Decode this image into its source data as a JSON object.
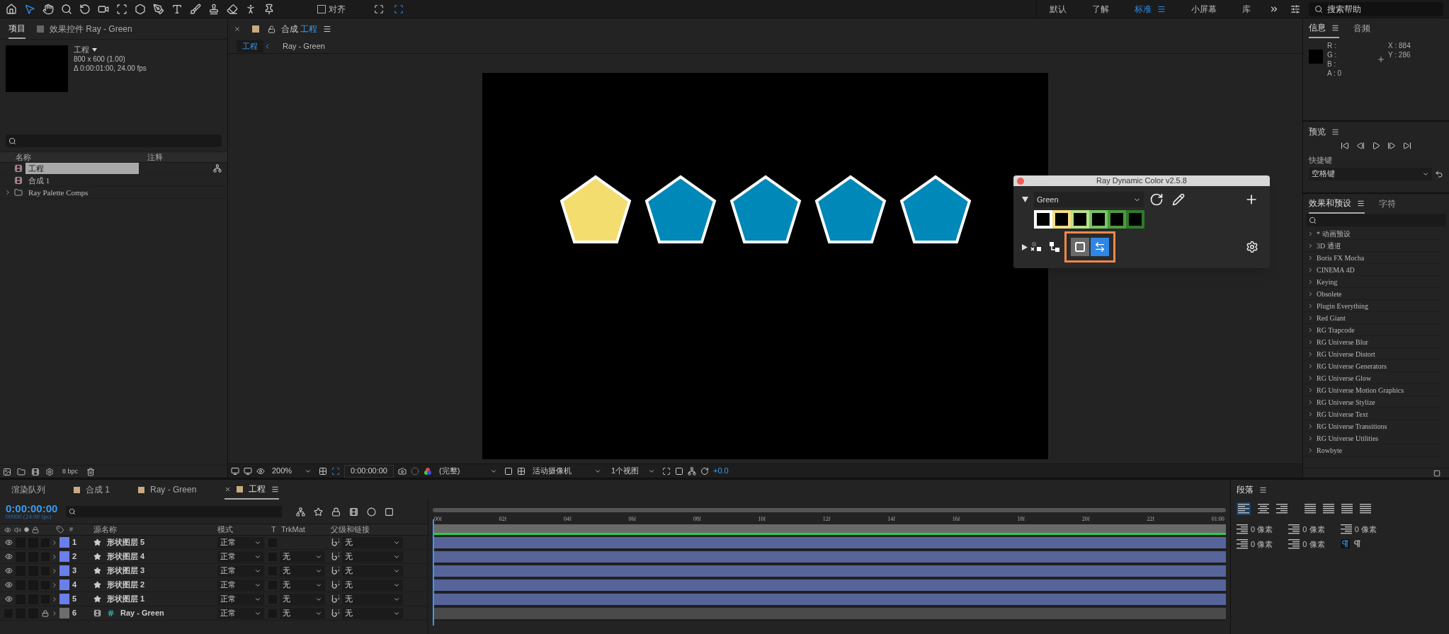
{
  "toolbar": {
    "snap": {
      "label": "对齐",
      "checked": false
    },
    "workspaces": [
      {
        "label": "默认",
        "selected": false
      },
      {
        "label": "了解",
        "selected": false
      },
      {
        "label": "标准",
        "selected": true
      },
      {
        "label": "小屏幕",
        "selected": false
      },
      {
        "label": "库",
        "selected": false
      }
    ],
    "search": {
      "placeholder": "搜索帮助"
    }
  },
  "project": {
    "tabs": [
      {
        "label": "项目",
        "selected": true
      },
      {
        "label": "效果控件 Ray - Green",
        "selected": false
      }
    ],
    "preview": {
      "name": "工程",
      "size": "800 x 600 (1.00)",
      "duration": "Δ 0:00:01:00, 24.00 fps"
    },
    "columns": [
      "名称",
      "注释"
    ],
    "items": [
      {
        "name": "工程",
        "kind": "comp",
        "selected": true
      },
      {
        "name": "合成 1",
        "kind": "comp",
        "selected": false
      },
      {
        "name": "Ray Palette Comps",
        "kind": "folder",
        "selected": false
      }
    ],
    "bit_depth": "8 bpc"
  },
  "viewer": {
    "tab": {
      "prefix": "合成",
      "name": "工程"
    },
    "breadcrumbs": [
      {
        "label": "工程",
        "selected": true
      },
      {
        "label": "Ray - Green",
        "selected": false
      }
    ],
    "shapes": [
      {
        "color": "#f3dd6f"
      },
      {
        "color": "#0088b9"
      },
      {
        "color": "#0088b9"
      },
      {
        "color": "#0088b9"
      },
      {
        "color": "#0088b9"
      }
    ],
    "toolbar": {
      "zoom": "200%",
      "time": "0:00:00:00",
      "resolution": "(完整)",
      "camera": "活动摄像机",
      "views": "1个视图",
      "exposure": "+0.0"
    }
  },
  "plugin": {
    "title": "Ray Dynamic Color v2.5.8",
    "palette": "Green",
    "swatches": [
      {
        "color": "#ffffff"
      },
      {
        "color": "#f2de84"
      },
      {
        "color": "#b6e08a"
      },
      {
        "color": "#79c464"
      },
      {
        "color": "#4c9a3e"
      },
      {
        "color": "#2f7a2b"
      }
    ],
    "toggles": [
      {
        "kind": "stroke",
        "on": false
      },
      {
        "kind": "swap",
        "on": true
      }
    ]
  },
  "info": {
    "tabs": [
      {
        "label": "信息",
        "selected": true
      },
      {
        "label": "音频",
        "selected": false
      }
    ],
    "channels": [
      "R :",
      "G :",
      "B :",
      "A :  0"
    ],
    "coords": [
      "X : 884",
      "Y : 286"
    ]
  },
  "preview": {
    "title": "预览",
    "shortcut_label": "快捷键",
    "shortcut": "空格键"
  },
  "effects": {
    "tabs": [
      {
        "label": "效果和预设",
        "selected": true
      },
      {
        "label": "字符",
        "selected": false
      }
    ],
    "items": [
      "* 动画预设",
      "3D 通道",
      "Boris FX Mocha",
      "CINEMA 4D",
      "Keying",
      "Obsolete",
      "Plugin Everything",
      "Red Giant",
      "RG Trapcode",
      "RG Universe Blur",
      "RG Universe Distort",
      "RG Universe Generators",
      "RG Universe Glow",
      "RG Universe Motion Graphics",
      "RG Universe Stylize",
      "RG Universe Text",
      "RG Universe Transitions",
      "RG Universe Utilities",
      "Rowbyte"
    ]
  },
  "timeline": {
    "tabs": [
      {
        "label": "渲染队列",
        "kind": "queue",
        "selected": false
      },
      {
        "label": "合成 1",
        "kind": "comp",
        "selected": false
      },
      {
        "label": "Ray - Green",
        "kind": "comp",
        "selected": false
      },
      {
        "label": "工程",
        "kind": "comp",
        "selected": true
      }
    ],
    "time": "0:00:00:00",
    "frame": "00000 (24.00 fps)",
    "columns": {
      "number": "#",
      "name": "源名称",
      "mode": "模式",
      "t": "T",
      "trkmat": "TrkMat",
      "parent": "父级和链接"
    },
    "layers": [
      {
        "number": "1",
        "name": "形状图层 5",
        "kind": "shape",
        "visible": true,
        "locked": false,
        "color": "#6b7fe8",
        "mode": "正常",
        "parent": "无"
      },
      {
        "number": "2",
        "name": "形状图层 4",
        "kind": "shape",
        "visible": true,
        "locked": false,
        "color": "#6b7fe8",
        "mode": "正常",
        "trkmat": "无",
        "parent": "无"
      },
      {
        "number": "3",
        "name": "形状图层 3",
        "kind": "shape",
        "visible": true,
        "locked": false,
        "color": "#6b7fe8",
        "mode": "正常",
        "trkmat": "无",
        "parent": "无"
      },
      {
        "number": "4",
        "name": "形状图层 2",
        "kind": "shape",
        "visible": true,
        "locked": false,
        "color": "#6b7fe8",
        "mode": "正常",
        "trkmat": "无",
        "parent": "无"
      },
      {
        "number": "5",
        "name": "形状图层 1",
        "kind": "shape",
        "visible": true,
        "locked": false,
        "color": "#6b7fe8",
        "mode": "正常",
        "trkmat": "无",
        "parent": "无"
      },
      {
        "number": "6",
        "name": "Ray - Green",
        "kind": "comp",
        "visible": false,
        "locked": true,
        "color": "#6e6e6e",
        "mode": "正常",
        "trkmat": "无",
        "parent": "无"
      }
    ],
    "ruler": [
      "00f",
      "02f",
      "04f",
      "06f",
      "08f",
      "10f",
      "12f",
      "14f",
      "16f",
      "18f",
      "20f",
      "22f",
      "01:00"
    ]
  },
  "paragraph": {
    "title": "段落",
    "spacing": [
      "0 像素",
      "0 像素",
      "0 像素",
      "0 像素",
      "0 像素"
    ]
  }
}
